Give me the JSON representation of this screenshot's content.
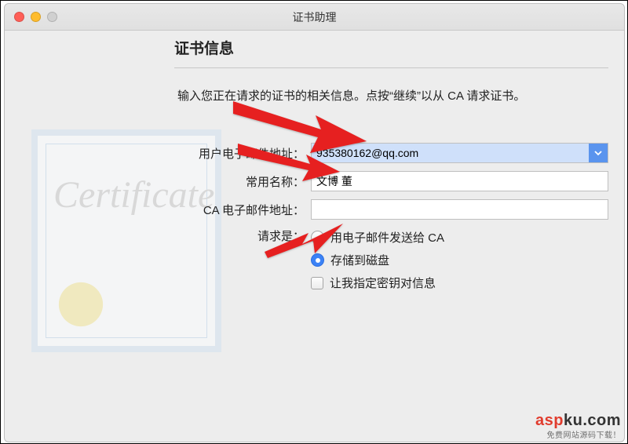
{
  "window": {
    "title": "证书助理"
  },
  "heading": "证书信息",
  "instructions": "输入您正在请求的证书的相关信息。点按“继续”以从 CA 请求证书。",
  "form": {
    "email_label": "用户电子邮件地址：",
    "email_value": "935380162@qq.com",
    "name_label": "常用名称：",
    "name_value": "文博 董",
    "ca_email_label": "CA 电子邮件地址：",
    "ca_email_value": "",
    "request_label": "请求是：",
    "opt_mail_ca": "用电子邮件发送给 CA",
    "opt_save_disk": "存储到磁盘",
    "opt_key_pair": "让我指定密钥对信息"
  },
  "cert_decor": "Certificate",
  "watermark": {
    "brand_a": "asp",
    "brand_b": "ku",
    "brand_c": ".com",
    "sub": "免费网站源码下载！"
  }
}
